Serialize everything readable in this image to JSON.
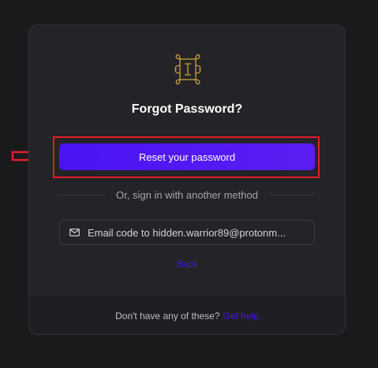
{
  "title": "Forgot Password?",
  "primary_button": "Reset your password",
  "divider_text": "Or, sign in with another method",
  "email_button": "Email code to hidden.warrior89@protonm...",
  "back_link": "Back",
  "footer": {
    "text": "Don't have any of these?",
    "link": "Get help"
  },
  "colors": {
    "accent": "#4a14f5",
    "link": "#4716e0",
    "logo": "#c9a23a",
    "annotation": "#e01e28",
    "background": "#1a191c",
    "card": "#242327"
  },
  "icons": {
    "logo": "ornate-frame-logo",
    "email": "mail-icon",
    "annotation": "arrow-right-icon"
  }
}
